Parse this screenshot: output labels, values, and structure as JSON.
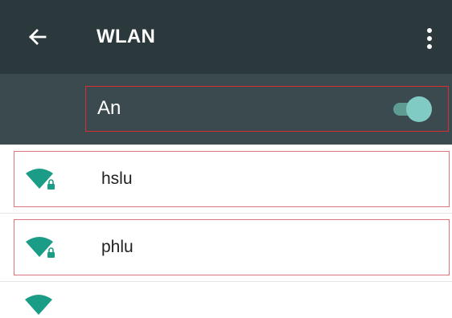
{
  "colors": {
    "toolbar_bg": "#2b383c",
    "master_bar_bg": "#3b4a4e",
    "accent": "#80cbc4",
    "wifi_icon": "#1b9c86",
    "highlight_border": "#d32f2f"
  },
  "toolbar": {
    "back_icon": "arrow-back-icon",
    "title": "WLAN",
    "menu_icon": "more-vert-icon"
  },
  "master_switch": {
    "label": "An",
    "state": "on"
  },
  "networks": [
    {
      "ssid": "hslu",
      "icon": "wifi-locked-icon",
      "secured": true
    },
    {
      "ssid": "phlu",
      "icon": "wifi-locked-icon",
      "secured": true
    }
  ]
}
